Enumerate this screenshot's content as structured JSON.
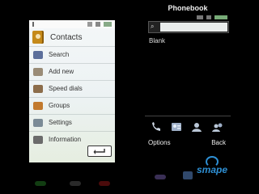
{
  "left": {
    "title": "Contacts",
    "menu": [
      {
        "label": "Search",
        "icon": "search-icon",
        "color": "#5c6f9b"
      },
      {
        "label": "Add new",
        "icon": "add-contact-icon",
        "color": "#9a8c77"
      },
      {
        "label": "Speed dials",
        "icon": "speed-dial-icon",
        "color": "#8c6d4b"
      },
      {
        "label": "Groups",
        "icon": "groups-icon",
        "color": "#c27a2e"
      },
      {
        "label": "Settings",
        "icon": "settings-icon",
        "color": "#7b8b96"
      },
      {
        "label": "Information",
        "icon": "info-icon",
        "color": "#6b6b6b"
      }
    ]
  },
  "right": {
    "title": "Phonebook",
    "search_placeholder": "",
    "list_items": [
      "Blank"
    ],
    "softkeys": {
      "left": "Options",
      "right": "Back"
    },
    "shortcut_icons": [
      "call-icon",
      "contact-card-icon",
      "contact-icon",
      "group-icon"
    ]
  },
  "watermark": "smape"
}
